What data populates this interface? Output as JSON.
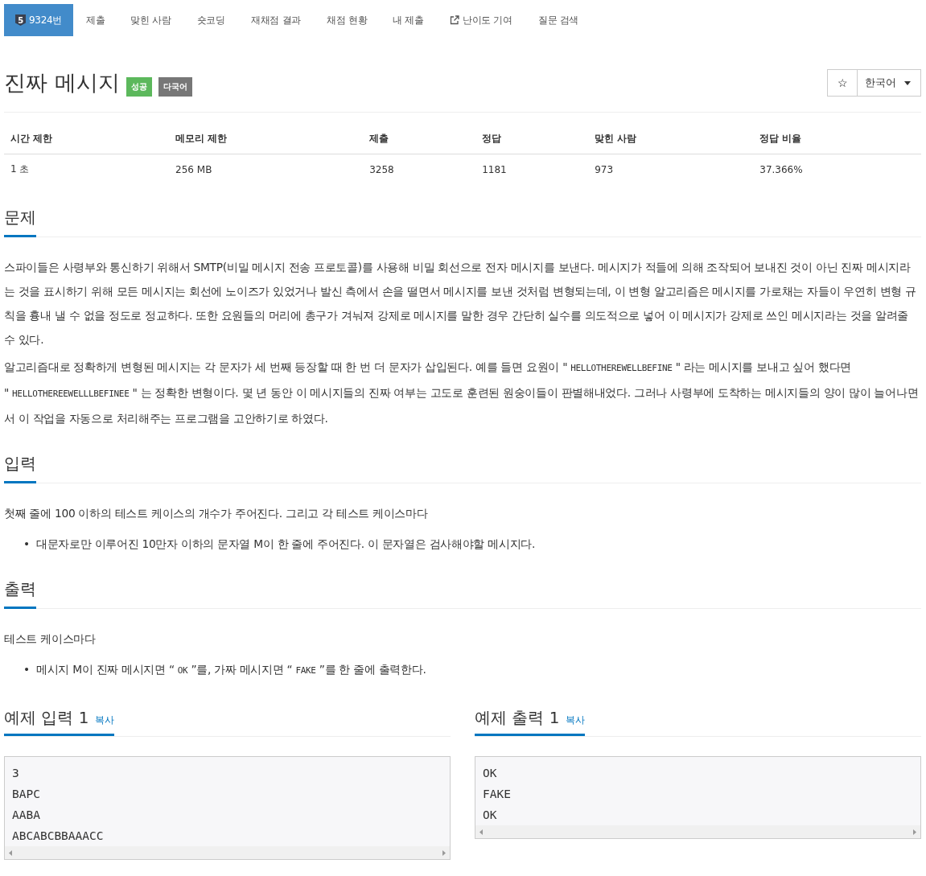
{
  "nav": {
    "problem": {
      "tier": "5",
      "label": "9324번",
      "selected": true
    },
    "items": [
      {
        "label": "제출",
        "selected": false,
        "kind": "plain"
      },
      {
        "label": "맞힌 사람",
        "selected": false,
        "kind": "plain"
      },
      {
        "label": "숏코딩",
        "selected": false,
        "kind": "plain"
      },
      {
        "label": "재채점 결과",
        "selected": false,
        "kind": "plain"
      },
      {
        "label": "채점 현황",
        "selected": false,
        "kind": "plain"
      },
      {
        "label": "내 제출",
        "selected": false,
        "kind": "plain"
      },
      {
        "label": "난이도 기여",
        "selected": false,
        "kind": "external"
      },
      {
        "label": "질문 검색",
        "selected": false,
        "kind": "plain"
      }
    ]
  },
  "title": "진짜 메시지",
  "labels": [
    {
      "text": "성공",
      "color": "#5cb85c"
    },
    {
      "text": "다국어",
      "color": "#777777"
    }
  ],
  "star_button": "☆",
  "language": "한국어",
  "info": {
    "columns": [
      "시간 제한",
      "메모리 제한",
      "제출",
      "정답",
      "맞힌 사람",
      "정답 비율"
    ],
    "values": [
      "1 초",
      "256 MB",
      "3258",
      "1181",
      "973",
      "37.366%"
    ]
  },
  "sections": [
    {
      "heading": "문제",
      "blocks": [
        {
          "kind": "paragraph",
          "parts": [
            {
              "kind": "text",
              "text": "스파이들은 사령부와 통신하기 위해서 SMTP(비밀 메시지 전송 프로토콜)를 사용해 비밀 회선으로 전자 메시지를 보낸다. 메시지가 적들에 의해 조작되어 보내진 것이 아닌 진짜 메시지라는 것을 표시하기 위해 모든 메시지는 회선에 노이즈가 있었거나 발신 측에서 손을 떨면서 메시지를 보낸 것처럼 변형되는데, 이 변형 알고리즘은 메시지를 가로채는 자들이 우연히 변형 규칙을 흉내 낼 수 없을 정도로 정교하다. 또한 요원들의 머리에 총구가 겨눠져 강제로 메시지를 말한 경우 간단히 실수를 의도적으로 넣어 이 메시지가 강제로 쓰인 메시지라는 것을 알려줄 수 있다."
            }
          ]
        },
        {
          "kind": "paragraph",
          "parts": [
            {
              "kind": "text",
              "text": "알고리즘대로 정확하게 변형된 메시지는 각 문자가 세 번째 등장할 때 한 번 더 문자가 삽입된다. 예를 들면 요원이 \""
            },
            {
              "kind": "code",
              "text": "HELLOTHEREWELLBEFINE"
            },
            {
              "kind": "text",
              "text": "\" 라는 메시지를 보내고 싶어 했다면 \""
            },
            {
              "kind": "code",
              "text": "HELLOTHEREEWELLLBEFINEE"
            },
            {
              "kind": "text",
              "text": "\" 는 정확한 변형이다. 몇 년 동안 이 메시지들의 진짜 여부는 고도로 훈련된 원숭이들이 판별해내었다. 그러나 사령부에 도착하는 메시지들의 양이 많이 늘어나면서 이 작업을 자동으로 처리해주는 프로그램을 고안하기로 하였다."
            }
          ]
        }
      ]
    },
    {
      "heading": "입력",
      "blocks": [
        {
          "kind": "paragraph",
          "parts": [
            {
              "kind": "text",
              "text": "첫째 줄에 100 이하의 테스트 케이스의 개수가 주어진다. 그리고 각 테스트 케이스마다"
            }
          ]
        },
        {
          "kind": "bullet",
          "marker": "•",
          "parts": [
            {
              "kind": "text",
              "text": "대문자로만 이루어진 10만자 이하의 문자열 M이 한 줄에 주어진다. 이 문자열은 검사해야할 메시지다."
            }
          ]
        }
      ]
    },
    {
      "heading": "출력",
      "blocks": [
        {
          "kind": "paragraph",
          "parts": [
            {
              "kind": "text",
              "text": "테스트 케이스마다"
            }
          ]
        },
        {
          "kind": "bullet",
          "marker": "•",
          "parts": [
            {
              "kind": "text",
              "text": "메시지 M이 진짜 메시지면 “"
            },
            {
              "kind": "code",
              "text": "OK"
            },
            {
              "kind": "text",
              "text": "”를, 가짜 메시지면 “"
            },
            {
              "kind": "code",
              "text": "FAKE"
            },
            {
              "kind": "text",
              "text": "”를 한 줄에 출력한다."
            }
          ]
        }
      ]
    }
  ],
  "samples": [
    {
      "heading": "예제 입력 1",
      "copy": "복사",
      "lines": [
        "3",
        "BAPC",
        "AABA",
        "ABCABCBBAAACC"
      ]
    },
    {
      "heading": "예제 출력 1",
      "copy": "복사",
      "lines": [
        "OK",
        "FAKE",
        "OK"
      ]
    }
  ]
}
